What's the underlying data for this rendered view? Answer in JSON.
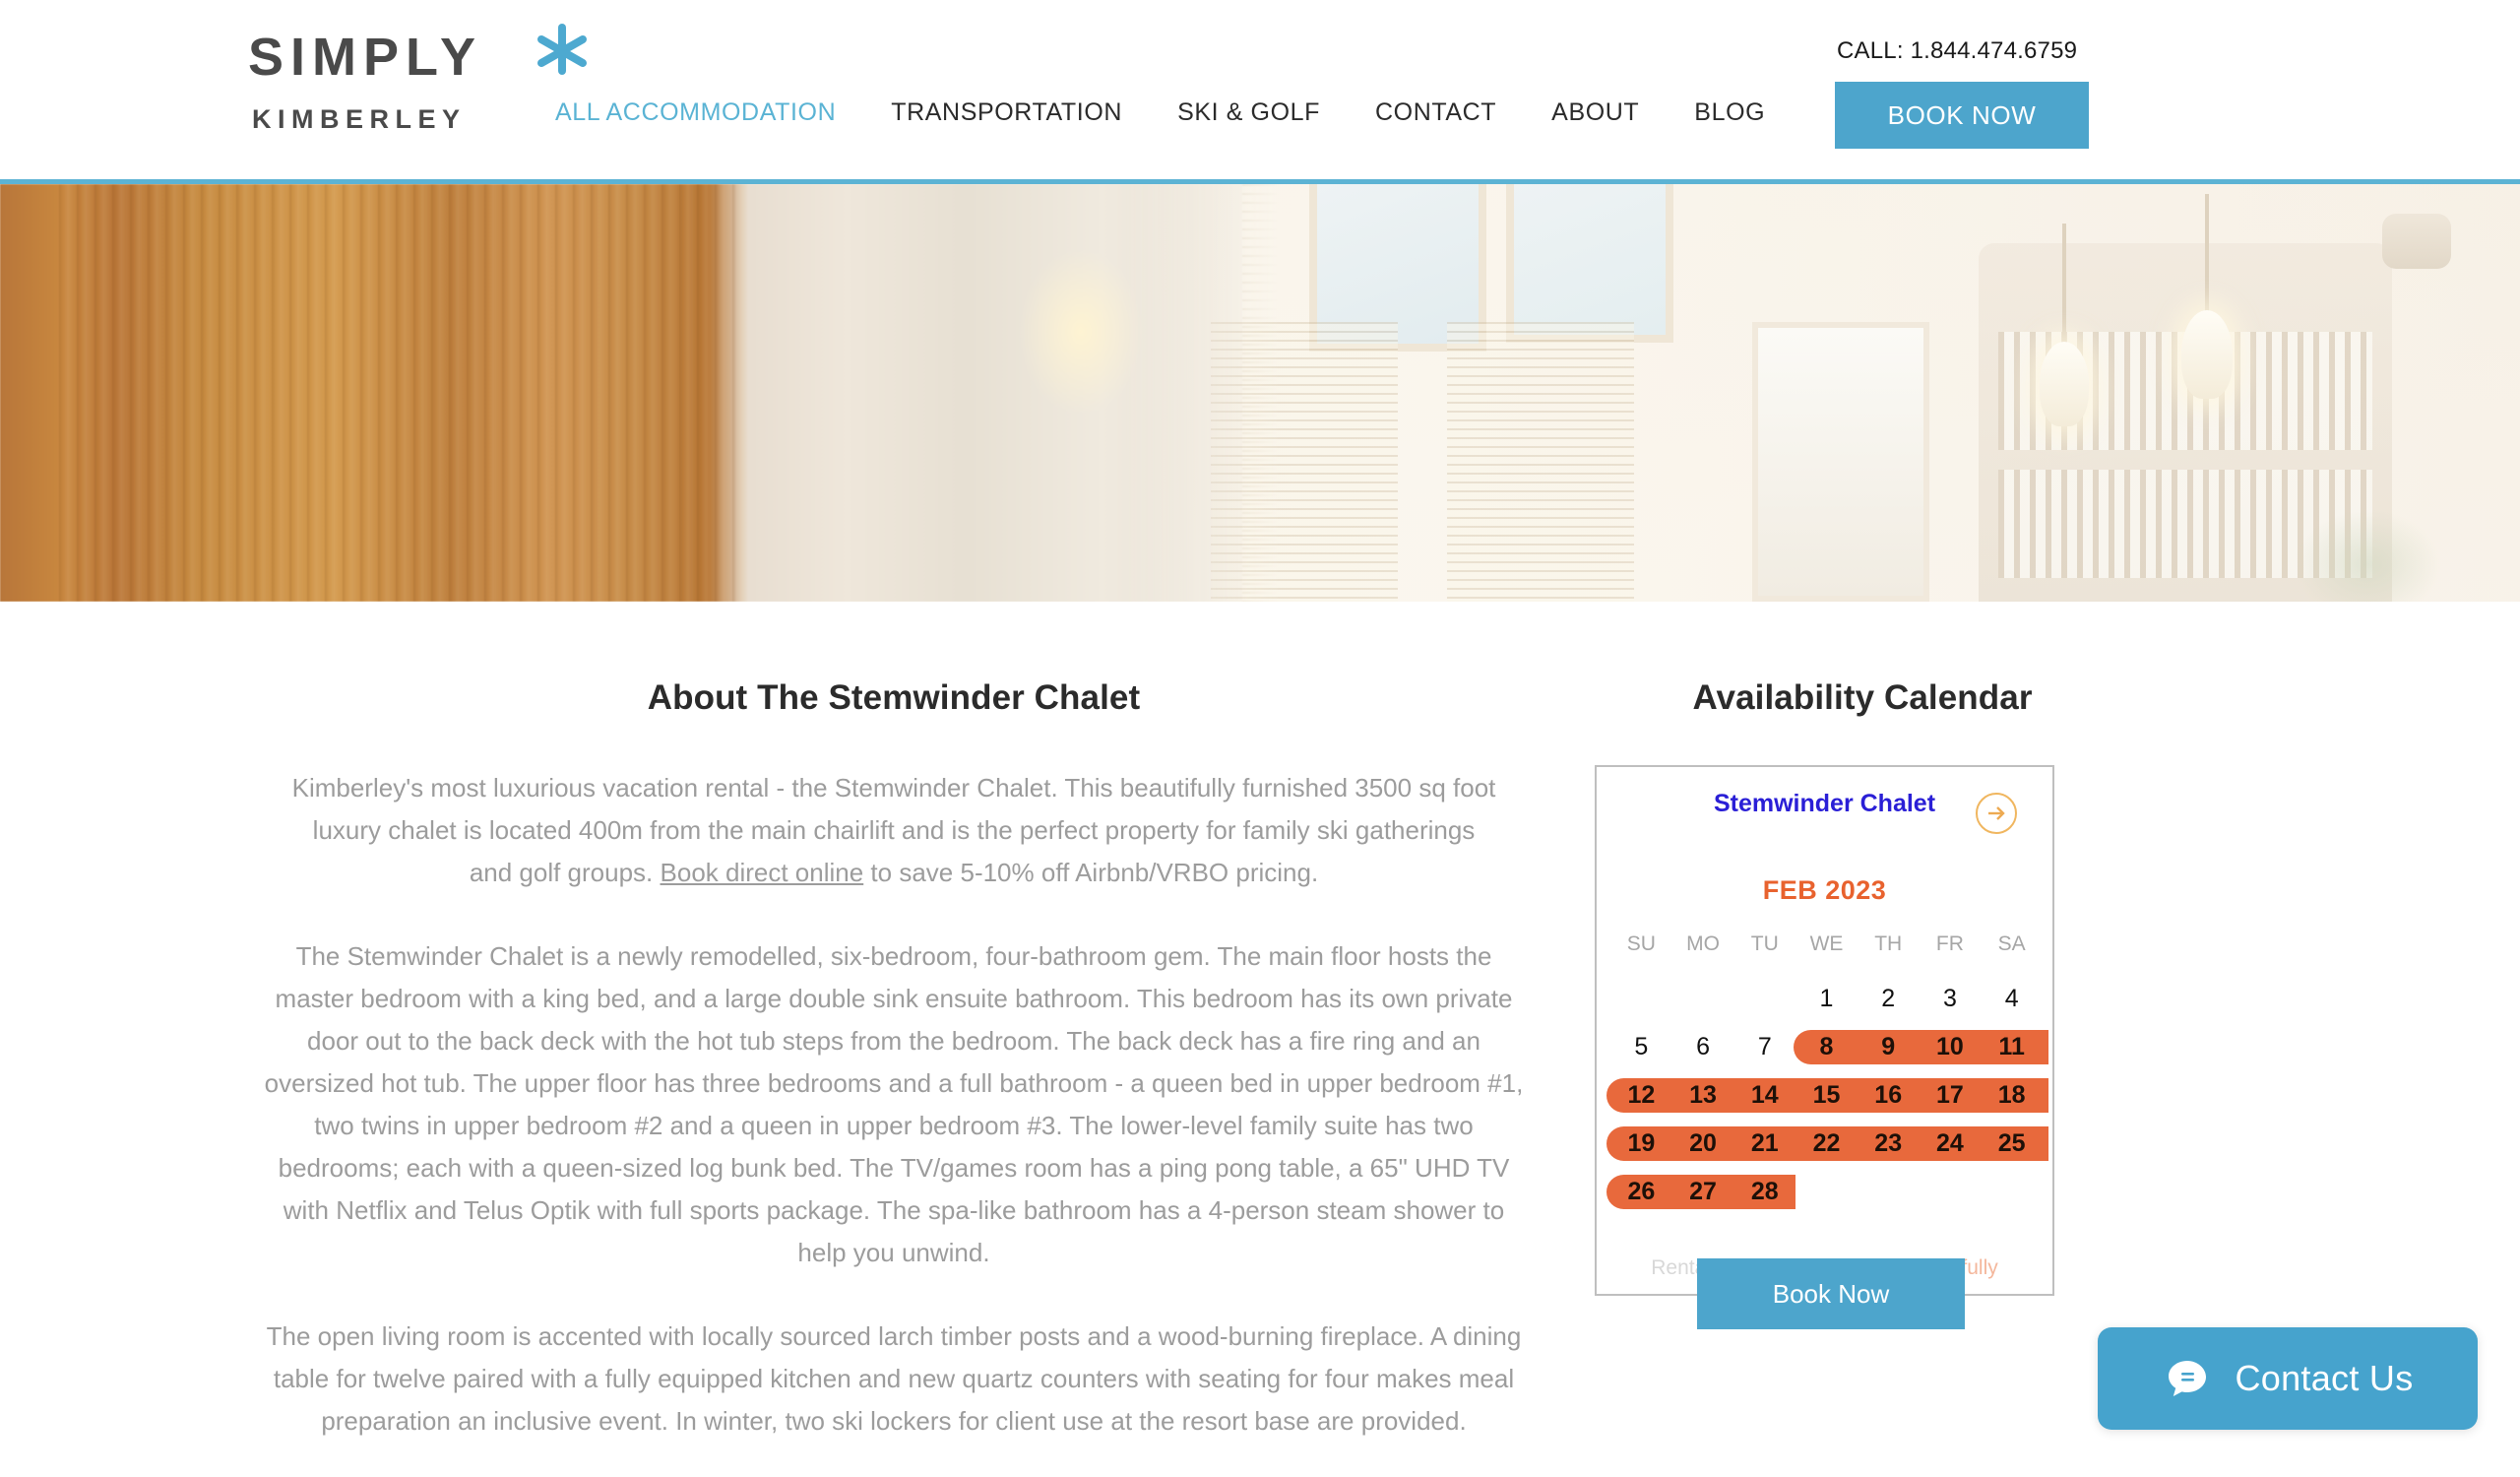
{
  "header": {
    "logo": {
      "line1": "SIMPLY",
      "line2": "KIMBERLEY",
      "star_icon": "asterisk-icon"
    },
    "nav": [
      {
        "label": "ALL ACCOMMODATION",
        "active": true
      },
      {
        "label": "TRANSPORTATION",
        "active": false
      },
      {
        "label": "SKI & GOLF",
        "active": false
      },
      {
        "label": "CONTACT",
        "active": false
      },
      {
        "label": "ABOUT",
        "active": false
      },
      {
        "label": "BLOG",
        "active": false
      }
    ],
    "call_text": "CALL: 1.844.474.6759",
    "book_now_label": "BOOK NOW",
    "accent_color": "#4da5cc",
    "nav_active_color": "#5ab3d4"
  },
  "hero": {
    "alt": "Stemwinder Chalet interior slideshow",
    "top_border_color": "#5cb3d4"
  },
  "about": {
    "title": "About The Stemwinder Chalet",
    "paragraphs": [
      {
        "pre": "Kimberley's most luxurious vacation rental - the Stemwinder Chalet. This beautifully furnished 3500 sq foot luxury chalet is located 400m from the main chairlift and is the perfect property for family ski gatherings and golf groups. ",
        "link": "Book direct online",
        "post": " to save 5-10% off Airbnb/VRBO pricing."
      },
      {
        "pre": "The Stemwinder Chalet is a newly remodelled, six-bedroom, four-bathroom gem. The main floor hosts the master bedroom with a king bed, and a large double sink ensuite bathroom. This bedroom has its own private door out to the back deck with the hot tub steps from the bedroom. The back deck has a fire ring and an oversized hot tub. The upper floor has three bedrooms and a full bathroom - a queen bed in upper bedroom #1, two twins in upper bedroom #2 and a queen in upper bedroom #3. The lower-level family suite has two bedrooms; each with a queen-sized log bunk bed. The TV/games room has a ping pong table, a 65\" UHD TV with Netflix and Telus Optik with full sports package. The spa-like bathroom has a 4-person steam shower to help you unwind."
      },
      {
        "pre": "The open living room is accented with locally sourced larch timber posts and a wood-burning fireplace. A dining table for twelve paired with a fully equipped kitchen and new quartz counters with seating for four makes meal preparation an inclusive event. In winter, two ski lockers for client use at the resort base are provided."
      }
    ]
  },
  "calendar": {
    "title": "Availability Calendar",
    "property_name": "Stemwinder Chalet",
    "next_icon": "arrow-right-circle-icon",
    "month_label": "FEB 2023",
    "weekdays": [
      "SU",
      "MO",
      "TU",
      "WE",
      "TH",
      "FR",
      "SA"
    ],
    "weeks": [
      [
        null,
        null,
        null,
        "1",
        "2",
        "3",
        "4"
      ],
      [
        "5",
        "6",
        "7",
        "8",
        "9",
        "10",
        "11"
      ],
      [
        "12",
        "13",
        "14",
        "15",
        "16",
        "17",
        "18"
      ],
      [
        "19",
        "20",
        "21",
        "22",
        "23",
        "24",
        "25"
      ],
      [
        "26",
        "27",
        "28",
        null,
        null,
        null,
        null
      ]
    ],
    "booked_days": [
      "8",
      "9",
      "10",
      "11",
      "12",
      "13",
      "14",
      "15",
      "16",
      "17",
      "18",
      "19",
      "20",
      "21",
      "22",
      "23",
      "24",
      "25",
      "26",
      "27",
      "28"
    ],
    "booked_color": "#e8693c",
    "footer_text": "Rental Calendar provided by ",
    "footer_brand": "Hostfully",
    "book_now_label": "Book Now"
  },
  "contact_widget": {
    "label": "Contact Us",
    "icon": "chat-bubble-icon",
    "color": "#46a3cd"
  }
}
